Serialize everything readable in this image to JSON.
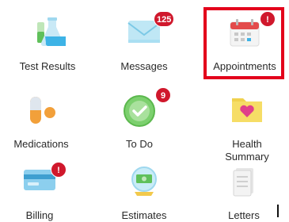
{
  "tiles": [
    {
      "label": "Test Results",
      "icon": "test-tubes-icon"
    },
    {
      "label": "Messages",
      "icon": "envelope-icon",
      "badge": "125"
    },
    {
      "label": "Appointments",
      "icon": "calendar-icon",
      "badge": "!"
    },
    {
      "label": "Medications",
      "icon": "pill-icon"
    },
    {
      "label": "To Do",
      "icon": "checkmark-icon",
      "badge": "9"
    },
    {
      "label": "Health\nSummary",
      "icon": "health-folder-icon"
    },
    {
      "label": "Billing",
      "icon": "credit-card-icon",
      "badge": "!"
    },
    {
      "label": "Estimates",
      "icon": "money-globe-icon"
    },
    {
      "label": "Letters",
      "icon": "letters-icon"
    }
  ],
  "colors": {
    "badge": "#d0182c",
    "highlight": "#e3001b"
  }
}
